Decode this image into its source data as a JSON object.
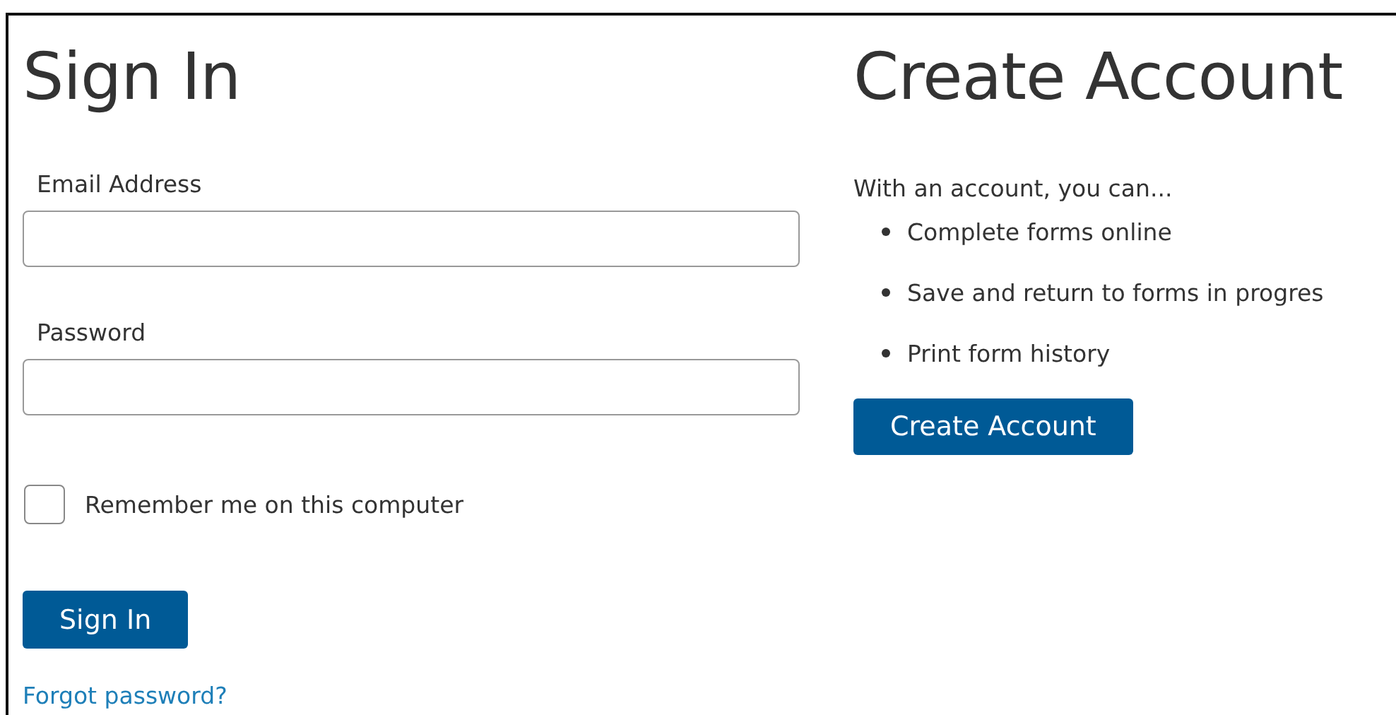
{
  "sign_in": {
    "title": "Sign In",
    "fields": [
      {
        "label": "Email Address"
      },
      {
        "label": "Password"
      }
    ],
    "remember": {
      "label": "Remember me on this computer",
      "checked": false
    },
    "button": "Sign In",
    "link": "Forgot password?"
  },
  "create_account": {
    "title": "Create Account",
    "intro": "With an account, you can...",
    "benefits": [
      "Complete forms online",
      "Save and return to forms in progres",
      "Print form history"
    ],
    "button": "Create Account"
  }
}
